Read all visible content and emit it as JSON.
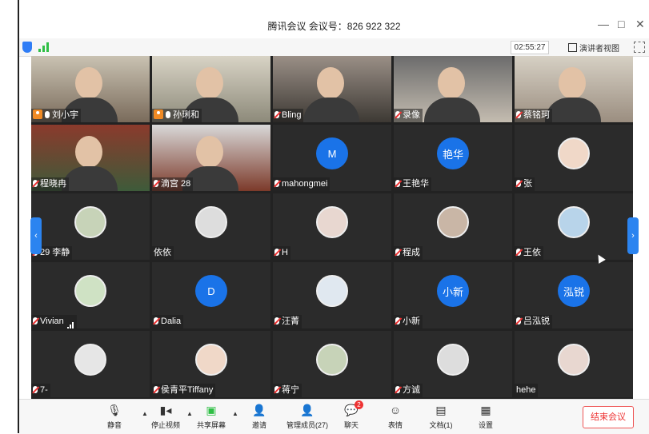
{
  "window": {
    "title": "腾讯会议 会议号：826 922 322",
    "minimize": "—",
    "maximize": "□",
    "close": "✕"
  },
  "topbar": {
    "timer": "02:55:27",
    "view_label": "演讲者视图",
    "shield_color": "#2f7df6"
  },
  "participants": [
    {
      "name": "刘小宇",
      "type": "video",
      "host": true,
      "muted": false
    },
    {
      "name": "孙琍和",
      "type": "video",
      "host": true,
      "muted": false
    },
    {
      "name": "Bling",
      "type": "video",
      "muted": true
    },
    {
      "name": "录像",
      "type": "video",
      "muted": true
    },
    {
      "name": "蔡铭珂",
      "type": "video",
      "muted": true
    },
    {
      "name": "程晓冉",
      "type": "video",
      "muted": true
    },
    {
      "name": "滴宫 28",
      "type": "video",
      "muted": true
    },
    {
      "name": "mahongmei",
      "type": "initial",
      "avatar_text": "M",
      "muted": true
    },
    {
      "name": "王艳华",
      "type": "initial",
      "avatar_text": "艳华",
      "muted": true
    },
    {
      "name": "张",
      "type": "photo",
      "muted": true
    },
    {
      "name": "29 李静",
      "type": "photo",
      "muted": true
    },
    {
      "name": "依依",
      "type": "photo",
      "muted": false,
      "nomic": true
    },
    {
      "name": "H",
      "type": "photo",
      "muted": true
    },
    {
      "name": "程成",
      "type": "photo",
      "muted": true
    },
    {
      "name": "王依",
      "type": "photo",
      "muted": true
    },
    {
      "name": "Vivian",
      "type": "photo",
      "muted": true,
      "signal": true
    },
    {
      "name": "Dalia",
      "type": "initial",
      "avatar_text": "D",
      "muted": true
    },
    {
      "name": "汪菁",
      "type": "photo",
      "muted": true
    },
    {
      "name": "小新",
      "type": "initial",
      "avatar_text": "小新",
      "muted": true
    },
    {
      "name": "吕泓锐",
      "type": "initial",
      "avatar_text": "泓锐",
      "muted": true
    },
    {
      "name": "7-",
      "type": "photo",
      "muted": true
    },
    {
      "name": "侯青平Tiffany",
      "type": "photo",
      "muted": true
    },
    {
      "name": "蒋宁",
      "type": "photo",
      "muted": true
    },
    {
      "name": "方诚",
      "type": "photo",
      "muted": true
    },
    {
      "name": "hehe",
      "type": "photo",
      "muted": false,
      "nomic": true
    }
  ],
  "pager": {
    "left": "‹",
    "right": "›"
  },
  "toolbar": {
    "mute": "静音",
    "stop_video": "停止视频",
    "share_screen": "共享屏幕",
    "invite": "邀请",
    "manage_members": "管理成员(27)",
    "chat": "聊天",
    "chat_badge": "2",
    "reactions": "表情",
    "documents": "文档(1)",
    "settings": "设置",
    "end_meeting": "结束会议"
  },
  "colors": {
    "accent_blue": "#1a73e8",
    "end_red": "#e33333",
    "host_orange": "#f08a24"
  }
}
